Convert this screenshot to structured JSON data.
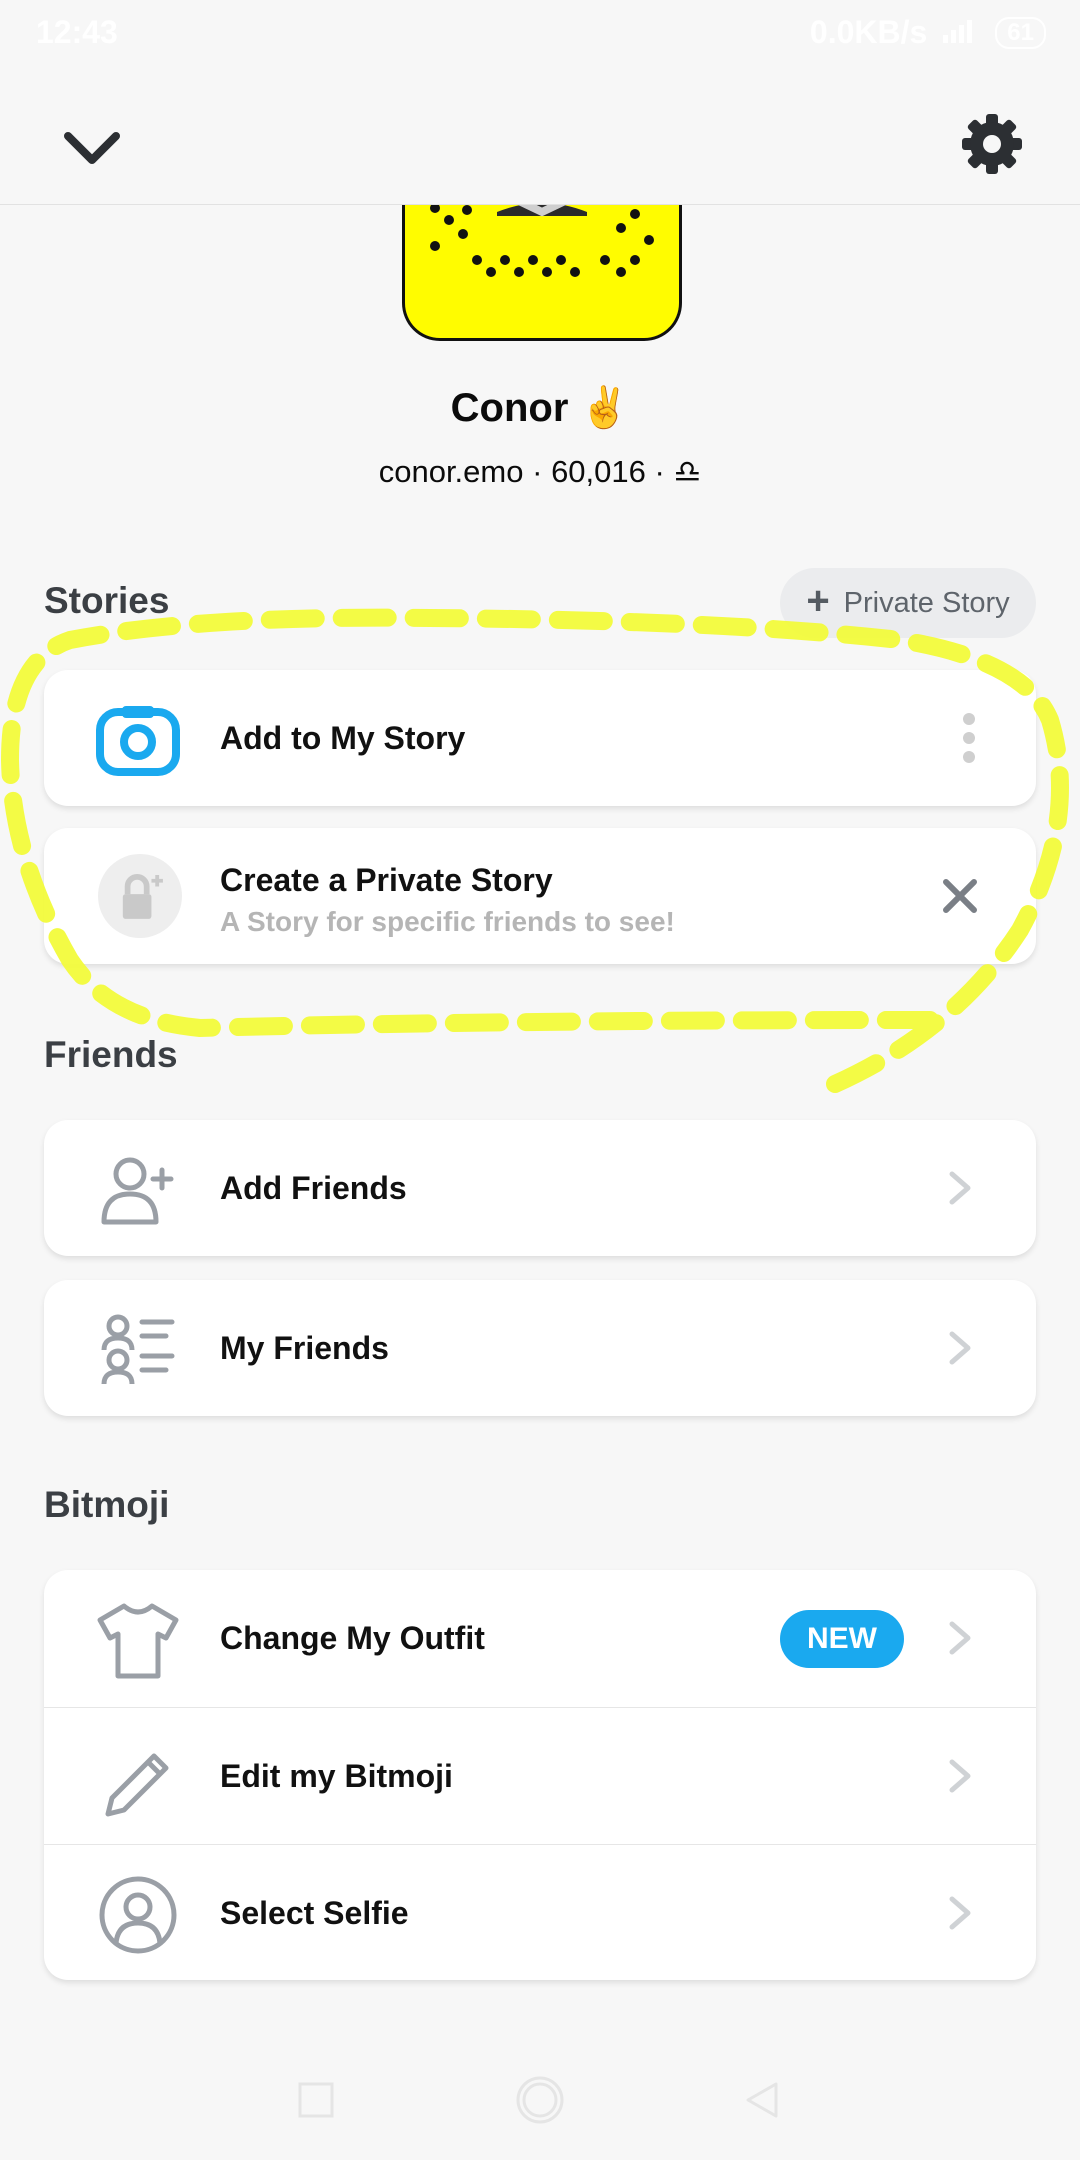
{
  "status_bar": {
    "time": "12:43",
    "network_speed": "0.0KB/s",
    "battery": "61"
  },
  "profile": {
    "display_name": "Conor",
    "display_emoji": "✌️",
    "username": "conor.emo",
    "separator": "·",
    "score": "60,016",
    "zodiac_symbol": "♎"
  },
  "stories": {
    "title": "Stories",
    "private_story_button": "Private Story",
    "items": [
      {
        "label": "Add to My Story"
      },
      {
        "label": "Create a Private Story",
        "sublabel": "A Story for specific friends to see!"
      }
    ]
  },
  "friends": {
    "title": "Friends",
    "items": [
      {
        "label": "Add Friends"
      },
      {
        "label": "My Friends"
      }
    ]
  },
  "bitmoji": {
    "title": "Bitmoji",
    "items": [
      {
        "label": "Change My Outfit",
        "badge": "NEW"
      },
      {
        "label": "Edit my Bitmoji"
      },
      {
        "label": "Select Selfie"
      }
    ]
  },
  "colors": {
    "snapcode_yellow": "#fffc00",
    "accent_blue": "#1aa9ef",
    "highlight_annotation": "#f2fb3b"
  }
}
